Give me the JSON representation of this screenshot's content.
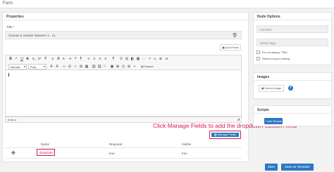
{
  "window": {
    "title": "Form"
  },
  "properties": {
    "heading": "Properties",
    "title_label": "Title *",
    "title_value": "Choose a number between 1 - 11",
    "add_fields_label": "Add Fields"
  },
  "editor": {
    "toolbar_row1": [
      "B",
      "I",
      "U",
      "S",
      "x₂",
      "x²",
      "T̸",
      "≡",
      "≣",
      "⇤",
      "⇥",
      "❝",
      "¶",
      "≡",
      "≡",
      "≡",
      "≡",
      "¶",
      "Ω",
      "⊞",
      "◧",
      "▦",
      "⋯",
      "↗",
      "☺",
      "⊕",
      "⇲"
    ],
    "format_label": "Normal",
    "font_label": "Font",
    "toolbar_row2_icons": [
      "A",
      "A",
      "▭",
      "⊟",
      "□",
      "⊞",
      "▦",
      "⛓",
      "⛓",
      "⚐",
      "▣",
      "⊠",
      "⊡",
      "⊞",
      "⋄"
    ],
    "source_label": "Source",
    "status_text": "body  p"
  },
  "node_options": {
    "heading": "Node Options",
    "identifier_placeholder": "Identifier",
    "tags_placeholder": "Select tags...",
    "checkbox1": "Do not display \"Title\"",
    "checkbox2": "Redirect upon clicking"
  },
  "images": {
    "heading": "Images",
    "select_label": "Select Image"
  },
  "scripts": {
    "heading": "Scripts",
    "add_label": "Add Scripts"
  },
  "callout": "Click Manage Fields to add the dropdown custom field",
  "manage_fields_label": "Manage Fields",
  "fields_table": {
    "headers": [
      "Name",
      "Required",
      "Visible"
    ],
    "rows": [
      {
        "name": "dropdown",
        "required": "true",
        "visible": "true"
      }
    ]
  },
  "footer": {
    "save_label": "Save",
    "save_template_label": "Save as Template"
  }
}
